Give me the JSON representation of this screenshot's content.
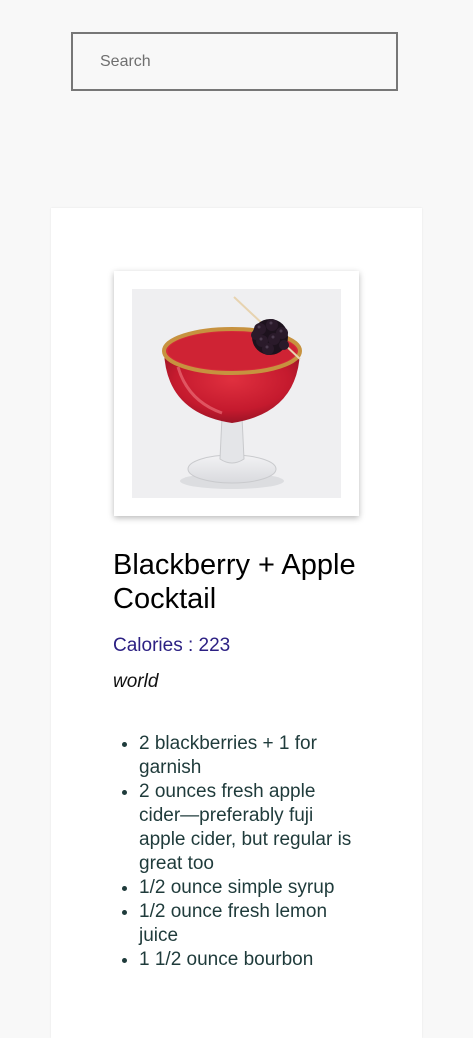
{
  "search": {
    "placeholder": "Search",
    "value": ""
  },
  "recipe": {
    "image_alt": "Blackberry + Apple Cocktail",
    "title": "Blackberry + Apple Cocktail",
    "calories_text": "Calories : 223",
    "origin": "world",
    "ingredients": [
      "2 blackberries + 1 for garnish",
      "2 ounces fresh apple cider—preferably fuji apple cider, but regular is great too",
      "1/2 ounce simple syrup",
      "1/2 ounce fresh lemon juice",
      "1 1/2 ounce bourbon"
    ]
  },
  "colors": {
    "calories": "#2c2083",
    "ingredient_text": "#1f3b3b",
    "search_border": "#777777"
  }
}
